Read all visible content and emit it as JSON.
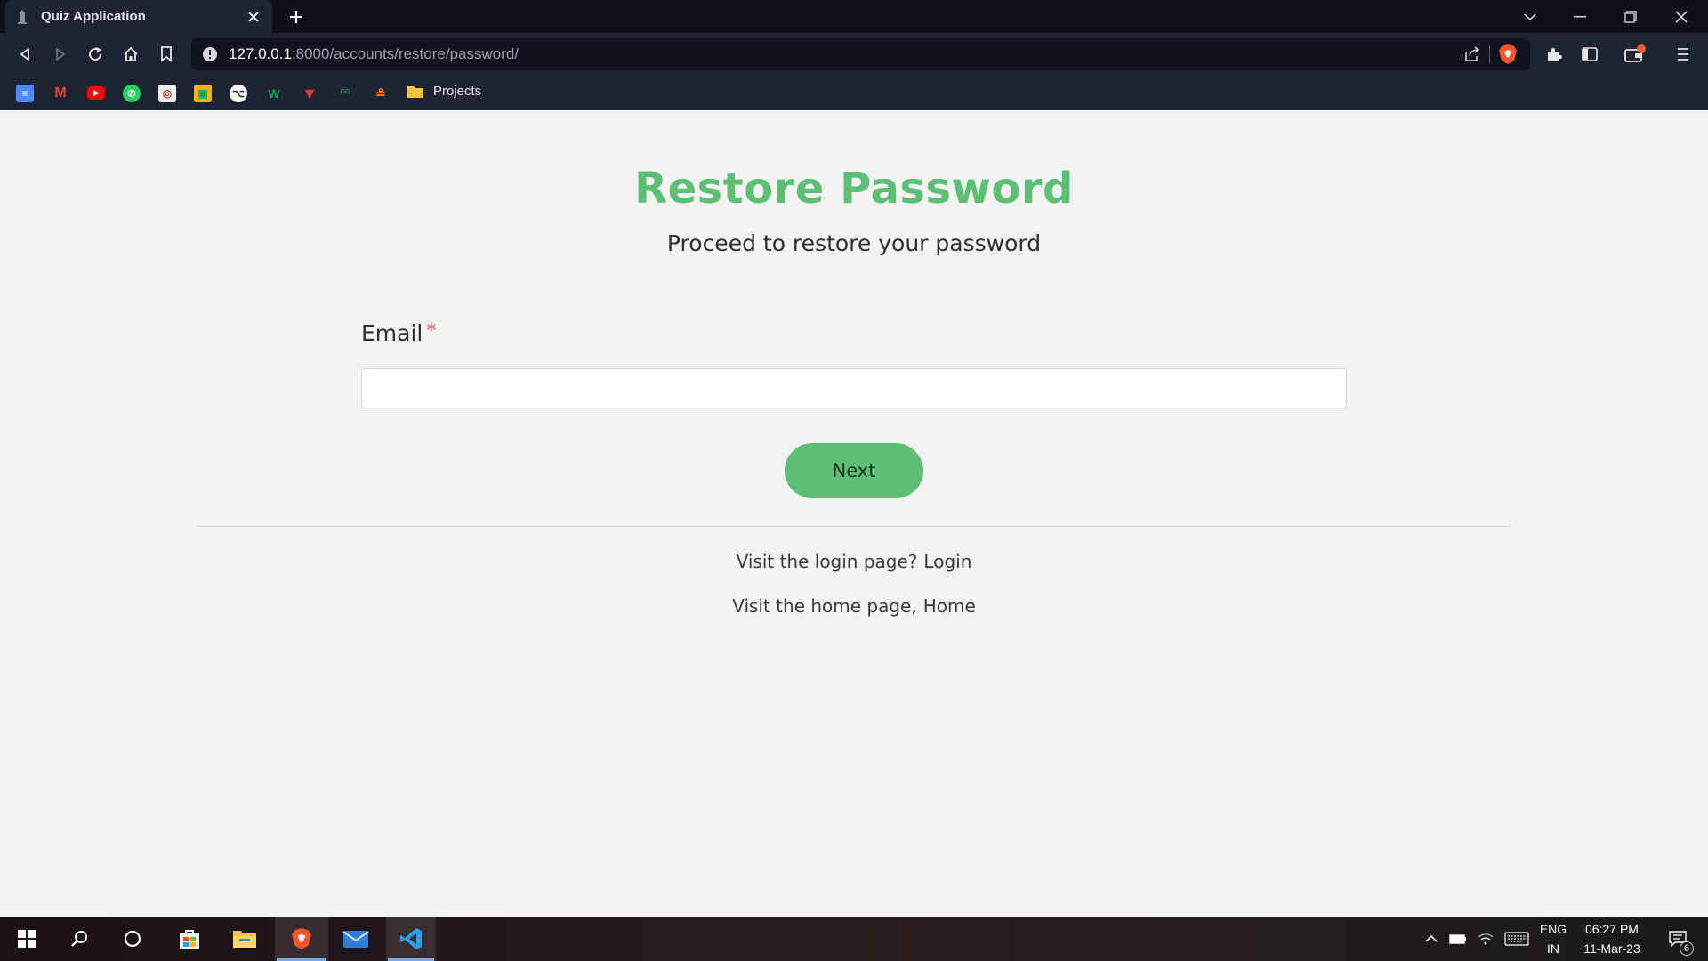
{
  "browser": {
    "tab_title": "Quiz Application",
    "url_host": "127.0.0.1",
    "url_rest": ":8000/accounts/restore/password/",
    "bookmarks_folder": "Projects"
  },
  "page": {
    "title": "Restore Password",
    "subtitle": "Proceed to restore your password",
    "email_label": "Email",
    "required_mark": "*",
    "email_value": "",
    "next_label": "Next",
    "login_prompt": "Visit the login page?",
    "login_link": "Login",
    "home_prompt": "Visit the home page,",
    "home_link": "Home"
  },
  "taskbar": {
    "language": "ENG",
    "region": "IN",
    "time": "06:27 PM",
    "date": "11-Mar-23",
    "notification_count": "6"
  },
  "colors": {
    "accent": "#5cbf73",
    "required": "#e35454",
    "chrome_dark": "#0e111a",
    "chrome": "#1f2433"
  }
}
